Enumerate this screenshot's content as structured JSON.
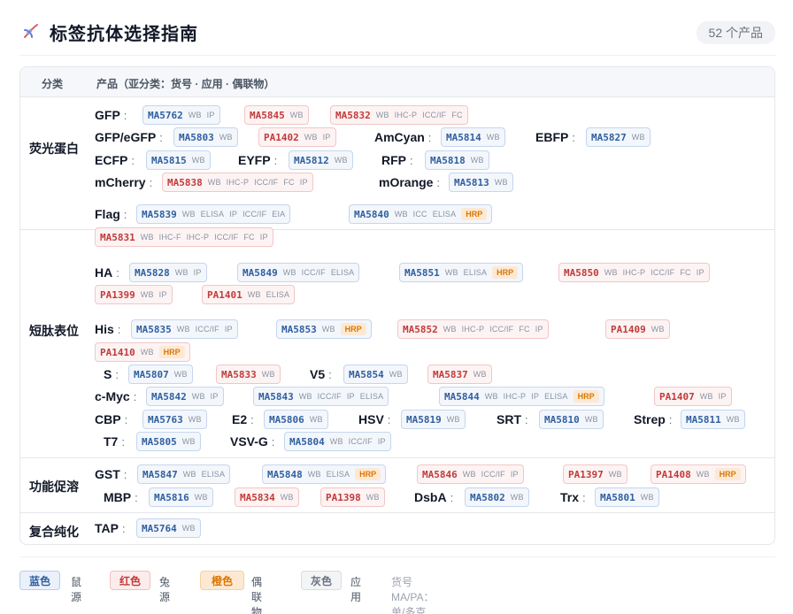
{
  "header": {
    "title": "标签抗体选择指南",
    "count": "52 个产品"
  },
  "table": {
    "col_category": "分类",
    "col_products": "产品（亚分类：货号 · 应用 · 偶联物）"
  },
  "colors": {
    "mouse": "#2f5fa0",
    "rabbit": "#c23a3a",
    "conjugate": "#d97706",
    "application": "#8a94a3"
  },
  "categories": [
    {
      "label": "荧光蛋白",
      "entries": [
        {
          "target": "GFP",
          "products": [
            {
              "cat": "MA5762",
              "host": "mouse",
              "apps": [
                "WB",
                "IP"
              ]
            },
            {
              "cat": "MA5845",
              "host": "rabbit",
              "apps": [
                "WB"
              ]
            },
            {
              "cat": "MA5832",
              "host": "rabbit",
              "apps": [
                "WB",
                "IHC-P",
                "ICC/IF",
                "FC"
              ]
            }
          ]
        },
        {
          "target": "GFP/eGFP",
          "products": [
            {
              "cat": "MA5803",
              "host": "mouse",
              "apps": [
                "WB"
              ]
            },
            {
              "cat": "PA1402",
              "host": "rabbit",
              "apps": [
                "WB",
                "IP"
              ]
            }
          ]
        },
        {
          "target": "AmCyan",
          "products": [
            {
              "cat": "MA5814",
              "host": "mouse",
              "apps": [
                "WB"
              ]
            }
          ]
        },
        {
          "target": "EBFP",
          "products": [
            {
              "cat": "MA5827",
              "host": "mouse",
              "apps": [
                "WB"
              ]
            }
          ]
        },
        {
          "target": "ECFP",
          "products": [
            {
              "cat": "MA5815",
              "host": "mouse",
              "apps": [
                "WB"
              ]
            }
          ]
        },
        {
          "target": "EYFP",
          "products": [
            {
              "cat": "MA5812",
              "host": "mouse",
              "apps": [
                "WB"
              ]
            }
          ]
        },
        {
          "target": "RFP",
          "products": [
            {
              "cat": "MA5818",
              "host": "mouse",
              "apps": [
                "WB"
              ]
            }
          ]
        },
        {
          "target": "mCherry",
          "products": [
            {
              "cat": "MA5838",
              "host": "rabbit",
              "apps": [
                "WB",
                "IHC-P",
                "ICC/IF",
                "FC",
                "IP"
              ]
            }
          ]
        },
        {
          "target": "mOrange",
          "products": [
            {
              "cat": "MA5813",
              "host": "mouse",
              "apps": [
                "WB"
              ]
            }
          ]
        }
      ]
    },
    {
      "label": "短肽表位",
      "entries": [
        {
          "target": "Flag",
          "products": [
            {
              "cat": "MA5839",
              "host": "mouse",
              "apps": [
                "WB",
                "ELISA",
                "IP",
                "ICC/IF",
                "EIA"
              ]
            },
            {
              "cat": "MA5840",
              "host": "mouse",
              "apps": [
                "WB",
                "ICC",
                "ELISA"
              ],
              "conj": "HRP"
            },
            {
              "cat": "MA5831",
              "host": "rabbit",
              "apps": [
                "WB",
                "IHC-F",
                "IHC-P",
                "ICC/IF",
                "FC",
                "IP"
              ]
            }
          ]
        },
        {
          "target": "HA",
          "products": [
            {
              "cat": "MA5828",
              "host": "mouse",
              "apps": [
                "WB",
                "IP"
              ]
            },
            {
              "cat": "MA5849",
              "host": "mouse",
              "apps": [
                "WB",
                "ICC/IF",
                "ELISA"
              ]
            },
            {
              "cat": "MA5851",
              "host": "mouse",
              "apps": [
                "WB",
                "ELISA"
              ],
              "conj": "HRP"
            },
            {
              "cat": "MA5850",
              "host": "rabbit",
              "apps": [
                "WB",
                "IHC-P",
                "ICC/IF",
                "FC",
                "IP"
              ]
            },
            {
              "cat": "PA1399",
              "host": "rabbit",
              "apps": [
                "WB",
                "IP"
              ]
            },
            {
              "cat": "PA1401",
              "host": "rabbit",
              "apps": [
                "WB",
                "ELISA"
              ]
            }
          ]
        },
        {
          "target": "His",
          "products": [
            {
              "cat": "MA5835",
              "host": "mouse",
              "apps": [
                "WB",
                "ICC/IF",
                "IP"
              ]
            },
            {
              "cat": "MA5853",
              "host": "mouse",
              "apps": [
                "WB"
              ],
              "conj": "HRP"
            },
            {
              "cat": "MA5852",
              "host": "rabbit",
              "apps": [
                "WB",
                "IHC-P",
                "ICC/IF",
                "FC",
                "IP"
              ]
            },
            {
              "cat": "PA1409",
              "host": "rabbit",
              "apps": [
                "WB"
              ]
            },
            {
              "cat": "PA1410",
              "host": "rabbit",
              "apps": [
                "WB"
              ],
              "conj": "HRP"
            }
          ]
        },
        {
          "target": "S",
          "products": [
            {
              "cat": "MA5807",
              "host": "mouse",
              "apps": [
                "WB"
              ]
            },
            {
              "cat": "MA5833",
              "host": "rabbit",
              "apps": [
                "WB"
              ]
            }
          ]
        },
        {
          "target": "V5",
          "products": [
            {
              "cat": "MA5854",
              "host": "mouse",
              "apps": [
                "WB"
              ]
            },
            {
              "cat": "MA5837",
              "host": "rabbit",
              "apps": [
                "WB"
              ]
            }
          ]
        },
        {
          "target": "c-Myc",
          "products": [
            {
              "cat": "MA5842",
              "host": "mouse",
              "apps": [
                "WB",
                "IP"
              ]
            },
            {
              "cat": "MA5843",
              "host": "mouse",
              "apps": [
                "WB",
                "ICC/IF",
                "IP",
                "ELISA"
              ]
            },
            {
              "cat": "MA5844",
              "host": "mouse",
              "apps": [
                "WB",
                "IHC-P",
                "IP",
                "ELISA"
              ],
              "conj": "HRP"
            },
            {
              "cat": "PA1407",
              "host": "rabbit",
              "apps": [
                "WB",
                "IP"
              ]
            }
          ]
        },
        {
          "target": "CBP",
          "products": [
            {
              "cat": "MA5763",
              "host": "mouse",
              "apps": [
                "WB"
              ]
            }
          ]
        },
        {
          "target": "E2",
          "products": [
            {
              "cat": "MA5806",
              "host": "mouse",
              "apps": [
                "WB"
              ]
            }
          ]
        },
        {
          "target": "HSV",
          "products": [
            {
              "cat": "MA5819",
              "host": "mouse",
              "apps": [
                "WB"
              ]
            }
          ]
        },
        {
          "target": "SRT",
          "products": [
            {
              "cat": "MA5810",
              "host": "mouse",
              "apps": [
                "WB"
              ]
            }
          ]
        },
        {
          "target": "Strep",
          "products": [
            {
              "cat": "MA5811",
              "host": "mouse",
              "apps": [
                "WB"
              ]
            }
          ]
        },
        {
          "target": "T7",
          "products": [
            {
              "cat": "MA5805",
              "host": "mouse",
              "apps": [
                "WB"
              ]
            }
          ]
        },
        {
          "target": "VSV-G",
          "products": [
            {
              "cat": "MA5804",
              "host": "mouse",
              "apps": [
                "WB",
                "ICC/IF",
                "IP"
              ]
            }
          ]
        }
      ]
    },
    {
      "label": "功能促溶",
      "entries": [
        {
          "target": "GST",
          "products": [
            {
              "cat": "MA5847",
              "host": "mouse",
              "apps": [
                "WB",
                "ELISA"
              ]
            },
            {
              "cat": "MA5848",
              "host": "mouse",
              "apps": [
                "WB",
                "ELISA"
              ],
              "conj": "HRP"
            },
            {
              "cat": "MA5846",
              "host": "rabbit",
              "apps": [
                "WB",
                "ICC/IF",
                "IP"
              ]
            },
            {
              "cat": "PA1397",
              "host": "rabbit",
              "apps": [
                "WB"
              ]
            },
            {
              "cat": "PA1408",
              "host": "rabbit",
              "apps": [
                "WB"
              ],
              "conj": "HRP"
            }
          ]
        },
        {
          "target": "MBP",
          "products": [
            {
              "cat": "MA5816",
              "host": "mouse",
              "apps": [
                "WB"
              ]
            },
            {
              "cat": "MA5834",
              "host": "rabbit",
              "apps": [
                "WB"
              ]
            },
            {
              "cat": "PA1398",
              "host": "rabbit",
              "apps": [
                "WB"
              ]
            }
          ]
        },
        {
          "target": "DsbA",
          "products": [
            {
              "cat": "MA5802",
              "host": "mouse",
              "apps": [
                "WB"
              ]
            }
          ]
        },
        {
          "target": "Trx",
          "products": [
            {
              "cat": "MA5801",
              "host": "mouse",
              "apps": [
                "WB"
              ]
            }
          ]
        }
      ]
    },
    {
      "label": "复合纯化",
      "entries": [
        {
          "target": "TAP",
          "products": [
            {
              "cat": "MA5764",
              "host": "mouse",
              "apps": [
                "WB"
              ]
            }
          ]
        }
      ]
    }
  ],
  "legend": {
    "blue": "蓝色",
    "blue_desc": "鼠源",
    "red": "红色",
    "red_desc": "兔源",
    "orange": "橙色",
    "orange_desc": "偶联物",
    "gray": "灰色",
    "gray_desc": "应用",
    "note": "货号 MA/PA：单/多克隆抗体"
  }
}
